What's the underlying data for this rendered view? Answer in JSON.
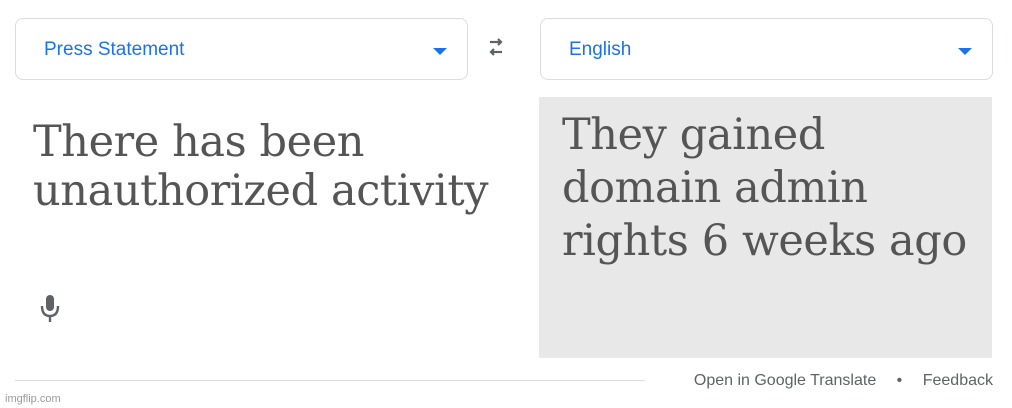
{
  "source_language": {
    "label": "Press Statement"
  },
  "target_language": {
    "label": "English"
  },
  "source_text": "There has been unauthorized activity",
  "target_text": "They gained domain admin rights 6 weeks ago",
  "footer": {
    "open_link": "Open in Google Translate",
    "separator": "•",
    "feedback_link": "Feedback"
  },
  "watermark": "imgflip.com",
  "icons": {
    "swap": "swap-arrows-icon",
    "caret": "chevron-down-icon",
    "mic": "microphone-icon"
  },
  "colors": {
    "accent": "#1a73e8",
    "text": "#555555",
    "panel_bg": "#e8e8e8",
    "border": "#dadce0"
  }
}
